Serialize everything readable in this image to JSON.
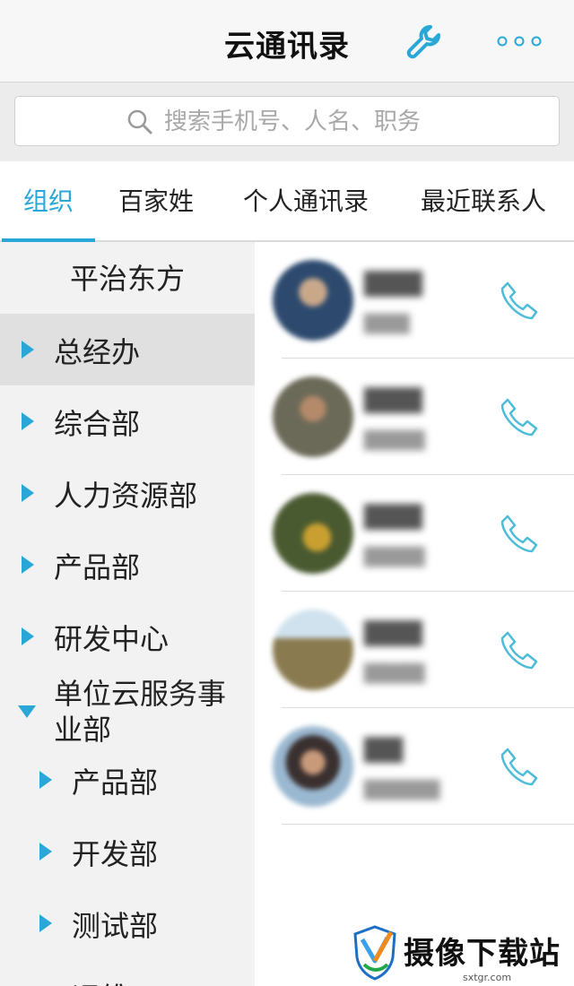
{
  "header": {
    "title": "云通讯录",
    "tool_icon": "wrench-icon",
    "more_icon": "more-dots-icon",
    "accent_color": "#29a8d8"
  },
  "search": {
    "placeholder": "搜索手机号、人名、职务",
    "value": ""
  },
  "tabs": [
    {
      "label": "组织",
      "active": true
    },
    {
      "label": "百家姓",
      "active": false
    },
    {
      "label": "个人通讯录",
      "active": false
    },
    {
      "label": "最近联系人",
      "active": false
    }
  ],
  "sidebar": {
    "org_name": "平治东方",
    "items": [
      {
        "label": "总经办",
        "selected": true
      },
      {
        "label": "综合部"
      },
      {
        "label": "人力资源部"
      },
      {
        "label": "产品部"
      },
      {
        "label": "研发中心"
      },
      {
        "label": "单位云服务事业部",
        "expanded": true
      },
      {
        "label": "产品部",
        "level": 2
      },
      {
        "label": "开发部",
        "level": 2
      },
      {
        "label": "测试部",
        "level": 2
      },
      {
        "label": "运维",
        "level": 2
      }
    ]
  },
  "contacts": [
    {
      "avatar_color": "#2d4a6e",
      "name_blurred": true
    },
    {
      "avatar_color": "#6b6a58",
      "name_blurred": true
    },
    {
      "avatar_color": "#5a6a3a",
      "name_blurred": true
    },
    {
      "avatar_color": "#9a8a70",
      "name_blurred": true
    },
    {
      "avatar_color": "#7a5a48",
      "name_blurred": true
    }
  ],
  "watermark": {
    "text": "摄像下载站",
    "domain": "sxtgr.com"
  }
}
